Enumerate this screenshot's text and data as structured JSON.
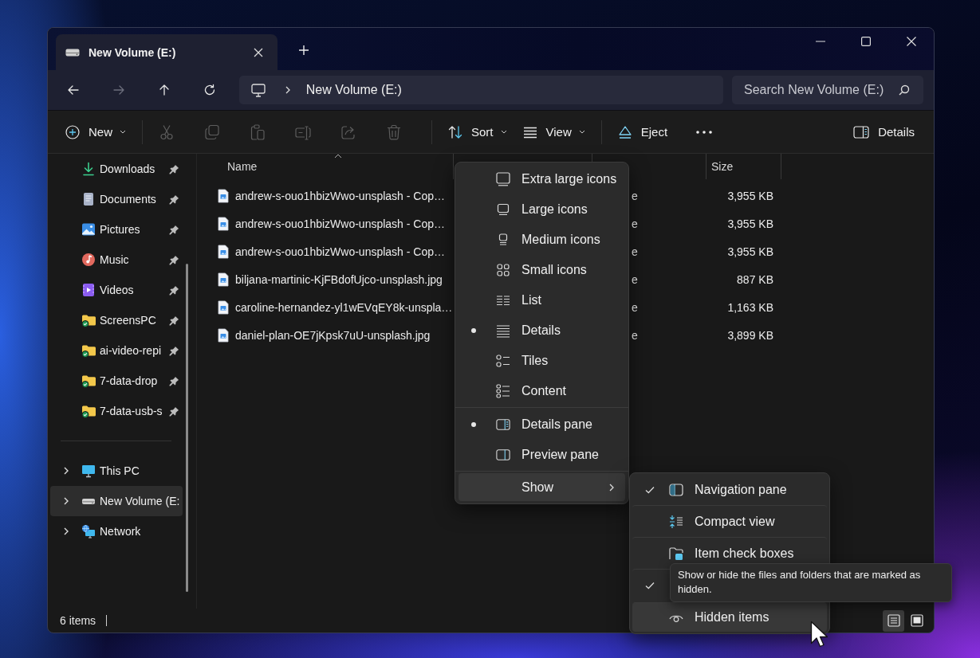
{
  "tab": {
    "title": "New Volume (E:)"
  },
  "nav_buttons": [
    {
      "kind": "back",
      "disabled": false
    },
    {
      "kind": "forward",
      "disabled": true
    },
    {
      "kind": "up",
      "disabled": false
    },
    {
      "kind": "refresh",
      "disabled": false
    }
  ],
  "address": {
    "segments": [
      "New Volume (E:)"
    ]
  },
  "search": {
    "placeholder": "Search New Volume (E:)"
  },
  "toolbar": {
    "new": {
      "label": "New"
    },
    "edit_actions": [
      {
        "kind": "cut",
        "disabled": true
      },
      {
        "kind": "copy",
        "disabled": true
      },
      {
        "kind": "paste",
        "disabled": true
      },
      {
        "kind": "rename",
        "disabled": true
      },
      {
        "kind": "share",
        "disabled": true
      },
      {
        "kind": "delete",
        "disabled": true
      }
    ],
    "sort": {
      "label": "Sort"
    },
    "view": {
      "label": "View"
    },
    "eject": {
      "label": "Eject"
    },
    "details": {
      "label": "Details"
    }
  },
  "sidebar": {
    "quick_access": [
      {
        "kind": "downloads",
        "label": "Downloads",
        "pinned": true
      },
      {
        "kind": "documents",
        "label": "Documents",
        "pinned": true
      },
      {
        "kind": "pictures",
        "label": "Pictures",
        "pinned": true
      },
      {
        "kind": "music",
        "label": "Music",
        "pinned": true
      },
      {
        "kind": "videos",
        "label": "Videos",
        "pinned": true
      },
      {
        "kind": "folder",
        "label": "ScreensPC",
        "pinned": true
      },
      {
        "kind": "folder",
        "label": "ai-video-repi",
        "pinned": true
      },
      {
        "kind": "folder",
        "label": "7-data-drop",
        "pinned": true
      },
      {
        "kind": "folder",
        "label": "7-data-usb-s",
        "pinned": true
      }
    ],
    "locations": [
      {
        "kind": "pc",
        "label": "This PC",
        "expanded": false,
        "selected": false
      },
      {
        "kind": "drive",
        "label": "New Volume (E:",
        "expanded": false,
        "selected": true
      },
      {
        "kind": "network",
        "label": "Network",
        "expanded": false,
        "selected": false
      }
    ]
  },
  "table": {
    "columns": [
      {
        "label": "Name",
        "sorted": true
      },
      {
        "label": "Size",
        "sorted": false
      }
    ],
    "rows": [
      {
        "name": "andrew-s-ouo1hbizWwo-unsplash - Cop…",
        "column_3": "e",
        "size": "3,955 KB"
      },
      {
        "name": "andrew-s-ouo1hbizWwo-unsplash - Cop…",
        "column_3": "e",
        "size": "3,955 KB"
      },
      {
        "name": "andrew-s-ouo1hbizWwo-unsplash - Cop…",
        "column_3": "e",
        "size": "3,955 KB"
      },
      {
        "name": "biljana-martinic-KjFBdofUjco-unsplash.jpg",
        "column_3": "e",
        "size": "887 KB"
      },
      {
        "name": "caroline-hernandez-yl1wEVqEY8k-unspla…",
        "column_3": "e",
        "size": "1,163 KB"
      },
      {
        "name": "daniel-plan-OE7jKpsk7uU-unsplash.jpg",
        "column_3": "e",
        "size": "3,899 KB"
      }
    ]
  },
  "status_bar": {
    "count": "6 items",
    "view_toggles": [
      {
        "kind": "details",
        "selected": true
      },
      {
        "kind": "large-icons",
        "selected": false
      }
    ]
  },
  "view_menu": {
    "layouts": [
      {
        "kind": "extra-large-icons",
        "label": "Extra large icons",
        "selected": false
      },
      {
        "kind": "large-icons",
        "label": "Large icons",
        "selected": false
      },
      {
        "kind": "medium-icons",
        "label": "Medium icons",
        "selected": false
      },
      {
        "kind": "small-icons",
        "label": "Small icons",
        "selected": false
      },
      {
        "kind": "list",
        "label": "List",
        "selected": false
      },
      {
        "kind": "details",
        "label": "Details",
        "selected": true
      },
      {
        "kind": "tiles",
        "label": "Tiles",
        "selected": false
      },
      {
        "kind": "content",
        "label": "Content",
        "selected": false
      }
    ],
    "panes": [
      {
        "kind": "details-pane",
        "label": "Details pane",
        "selected": true
      },
      {
        "kind": "preview-pane",
        "label": "Preview pane",
        "selected": false
      }
    ],
    "show": {
      "label": "Show",
      "highlighted": true
    }
  },
  "show_menu": {
    "items": [
      {
        "kind": "navigation-pane",
        "label": "Navigation pane",
        "checked": true,
        "highlighted": false
      },
      {
        "kind": "compact-view",
        "label": "Compact view",
        "checked": false,
        "highlighted": false
      },
      {
        "kind": "check-boxes",
        "label": "Item check boxes",
        "checked": false,
        "highlighted": false
      },
      {
        "kind": "covered",
        "checked": true,
        "highlighted": false
      },
      {
        "kind": "hidden-items",
        "label": "Hidden items",
        "checked": false,
        "highlighted": true
      }
    ]
  },
  "tooltip": {
    "text": "Show or hide the files and folders that are marked as hidden."
  }
}
